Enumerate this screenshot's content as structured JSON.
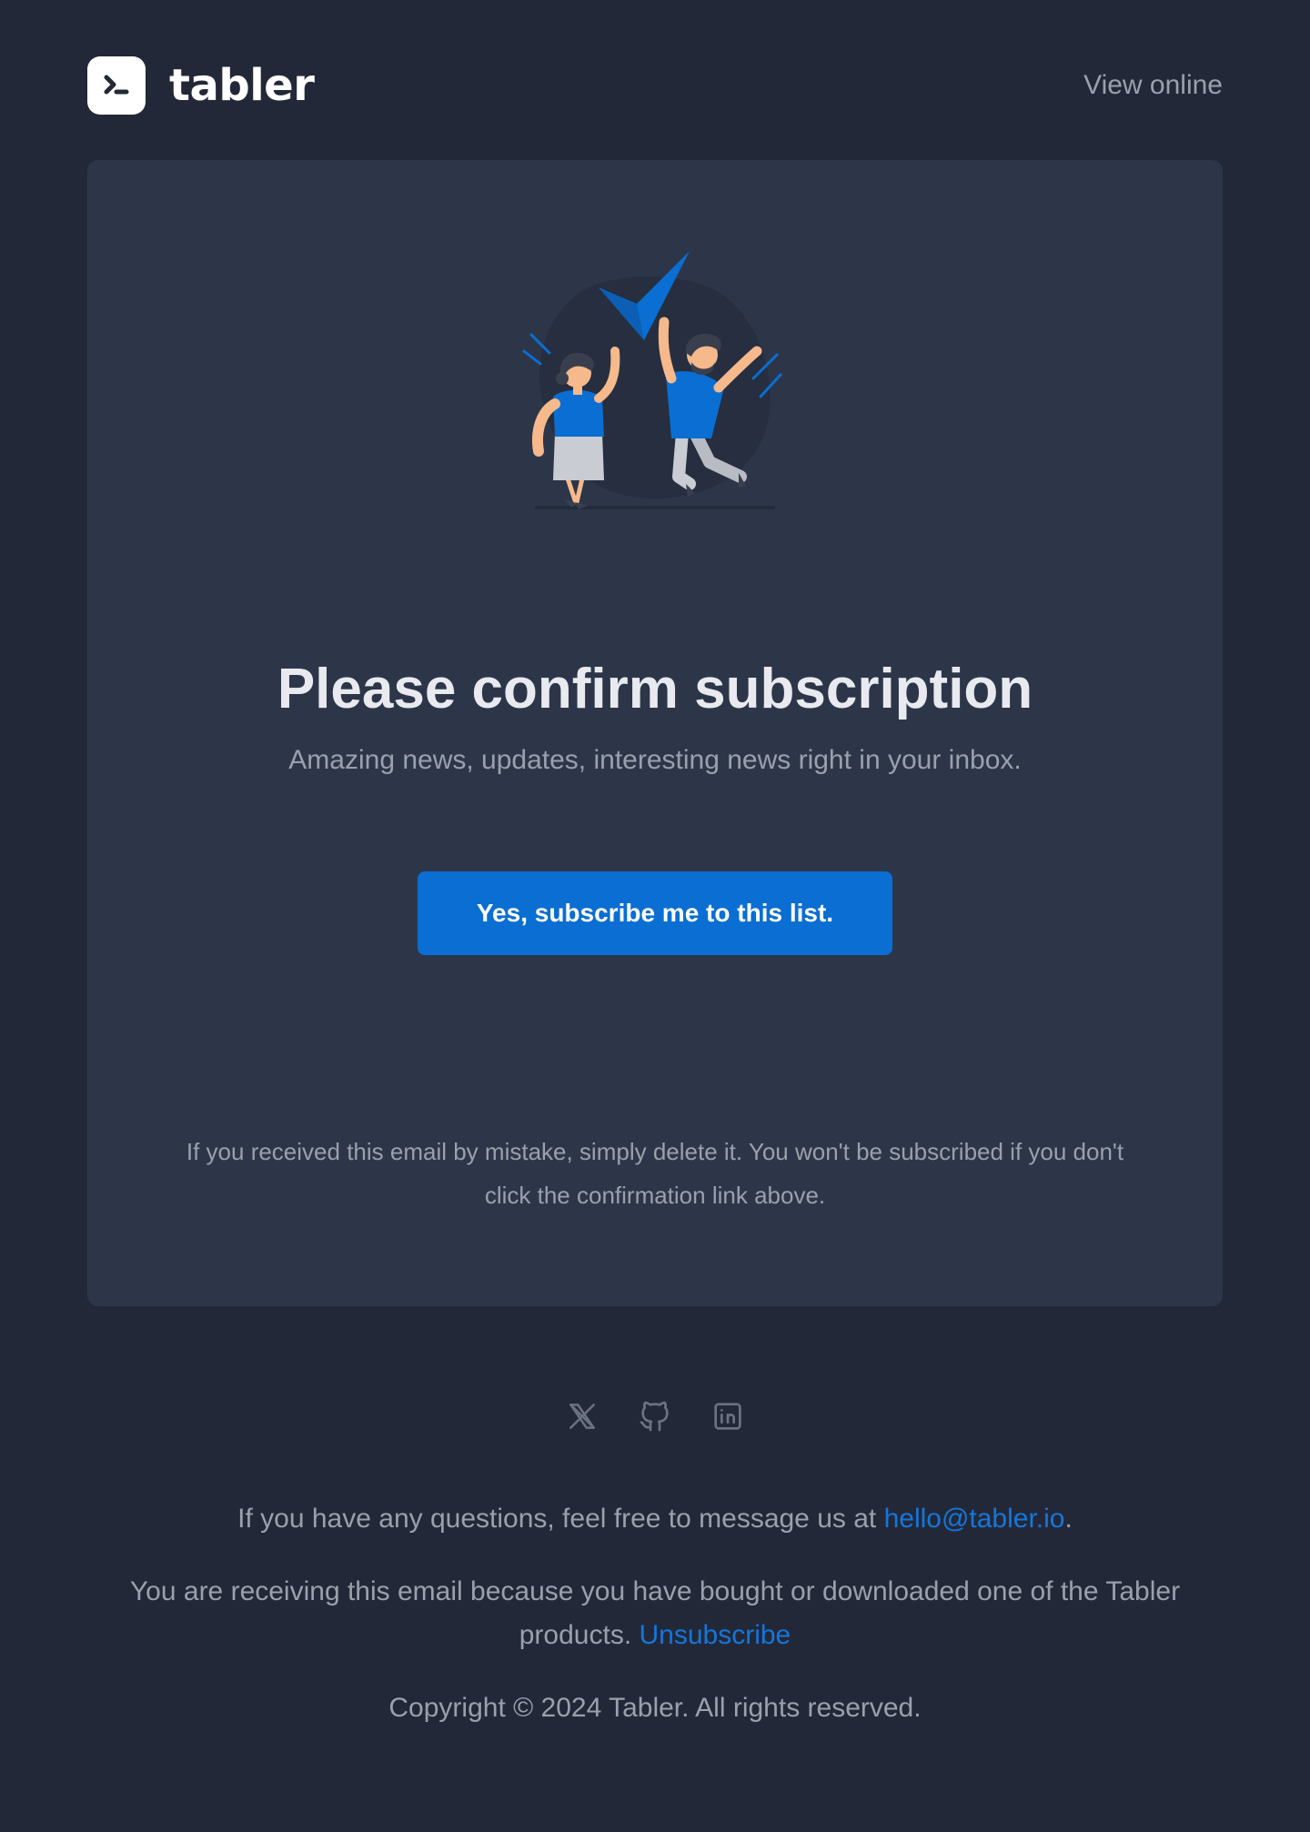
{
  "header": {
    "brand_name": "tabler",
    "view_online": "View online"
  },
  "card": {
    "headline": "Please confirm subscription",
    "subline": "Amazing news, updates, interesting news right in your inbox.",
    "cta_label": "Yes, subscribe me to this list.",
    "disclaimer": "If you received this email by mistake, simply delete it. You won't be subscribed if you don't click the confirmation link above."
  },
  "footer": {
    "social_icons": [
      "x-icon",
      "github-icon",
      "linkedin-icon"
    ],
    "questions_prefix": "If you have any questions, feel free to message us at ",
    "email": "hello@tabler.io",
    "questions_suffix": ".",
    "receiving_text": "You are receiving this email because you have bought or downloaded one of the Tabler products. ",
    "unsubscribe": "Unsubscribe",
    "copyright": "Copyright © 2024 Tabler. All rights reserved."
  },
  "colors": {
    "background": "#232838",
    "card": "#2d3649",
    "accent": "#0a6ed2",
    "link": "#1576db",
    "muted_text": "#9aa0ac",
    "heading_text": "#e8eaef"
  }
}
